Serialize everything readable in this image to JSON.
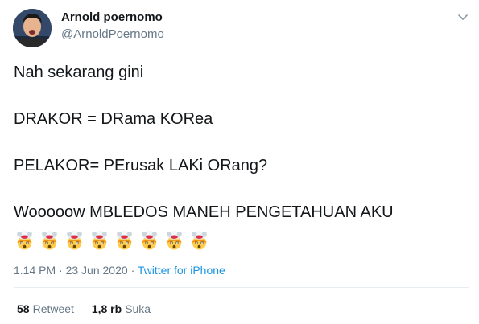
{
  "user": {
    "name": "Arnold poernomo",
    "handle": "@ArnoldPoernomo",
    "avatar_icon": "avatar-photo"
  },
  "menu_icon": "chevron-down-icon",
  "tweet": {
    "lines": [
      "Nah sekarang gini",
      "DRAKOR = DRama KORea",
      "PELAKOR= PErusak LAKi ORang?",
      "Wooooow MBLEDOS MANEH PENGETAHUAN AKU"
    ],
    "emoji_icon": "exploding-head-emoji",
    "emoji_count": 8
  },
  "meta": {
    "time": "1.14 PM",
    "separator": "·",
    "date": "23 Jun 2020",
    "source": "Twitter for iPhone"
  },
  "stats": {
    "retweets_count": "58",
    "retweets_label": "Retweet",
    "likes_count": "1,8 rb",
    "likes_label": "Suka"
  },
  "colors": {
    "text": "#14171a",
    "secondary": "#657786",
    "link": "#1b95e0",
    "divider": "#e6ecf0"
  }
}
